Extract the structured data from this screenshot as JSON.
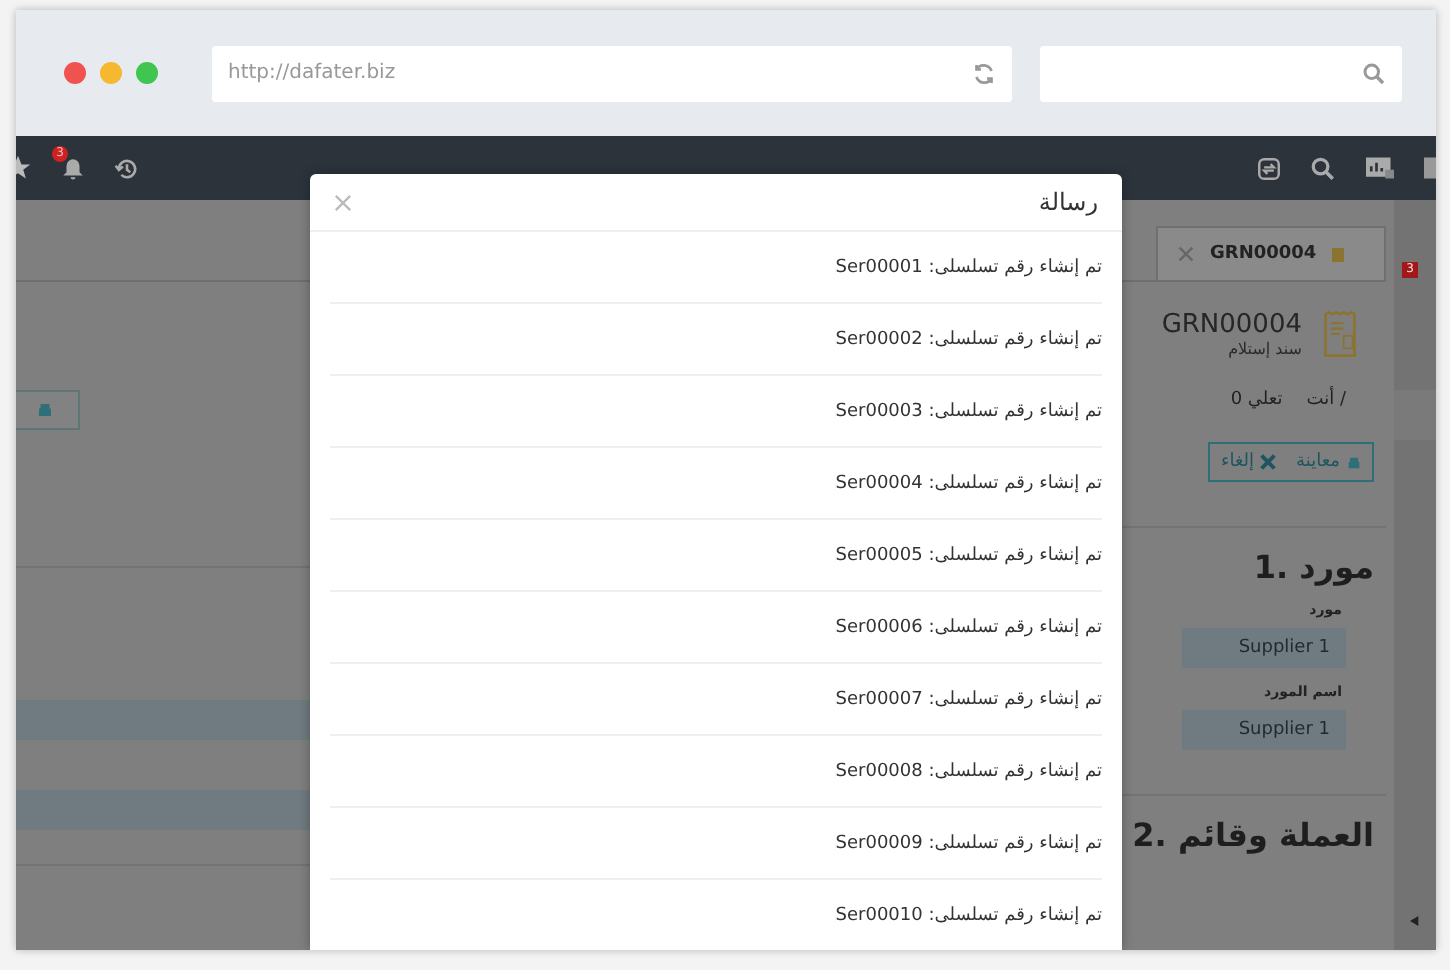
{
  "browser": {
    "url": "http://dafater.biz"
  },
  "nav": {
    "notification_count": "3"
  },
  "tab": {
    "label": "GRN00004"
  },
  "document": {
    "title": "GRN00004",
    "subtitle": "سند إستلام",
    "owner": "أنت /",
    "comments": "0 تعلي"
  },
  "actions": [
    {
      "kind": "preview",
      "label": "معاينة"
    },
    {
      "kind": "cancel",
      "label": "إلغاء"
    }
  ],
  "sidebar": {
    "badge": "3"
  },
  "sections": [
    {
      "title": "1. مورد",
      "fields": [
        {
          "label": "مورد",
          "value": "Supplier 1"
        },
        {
          "label": "اسم المورد",
          "value": "Supplier 1"
        }
      ]
    },
    {
      "title": "2. العملة وقائم"
    }
  ],
  "dialog": {
    "title": "رسالة",
    "messages": [
      "تم إنشاء رقم تسلسلى: Ser00001",
      "تم إنشاء رقم تسلسلى: Ser00002",
      "تم إنشاء رقم تسلسلى: Ser00003",
      "تم إنشاء رقم تسلسلى: Ser00004",
      "تم إنشاء رقم تسلسلى: Ser00005",
      "تم إنشاء رقم تسلسلى: Ser00006",
      "تم إنشاء رقم تسلسلى: Ser00007",
      "تم إنشاء رقم تسلسلى: Ser00008",
      "تم إنشاء رقم تسلسلى: Ser00009",
      "تم إنشاء رقم تسلسلى: Ser00010"
    ]
  }
}
